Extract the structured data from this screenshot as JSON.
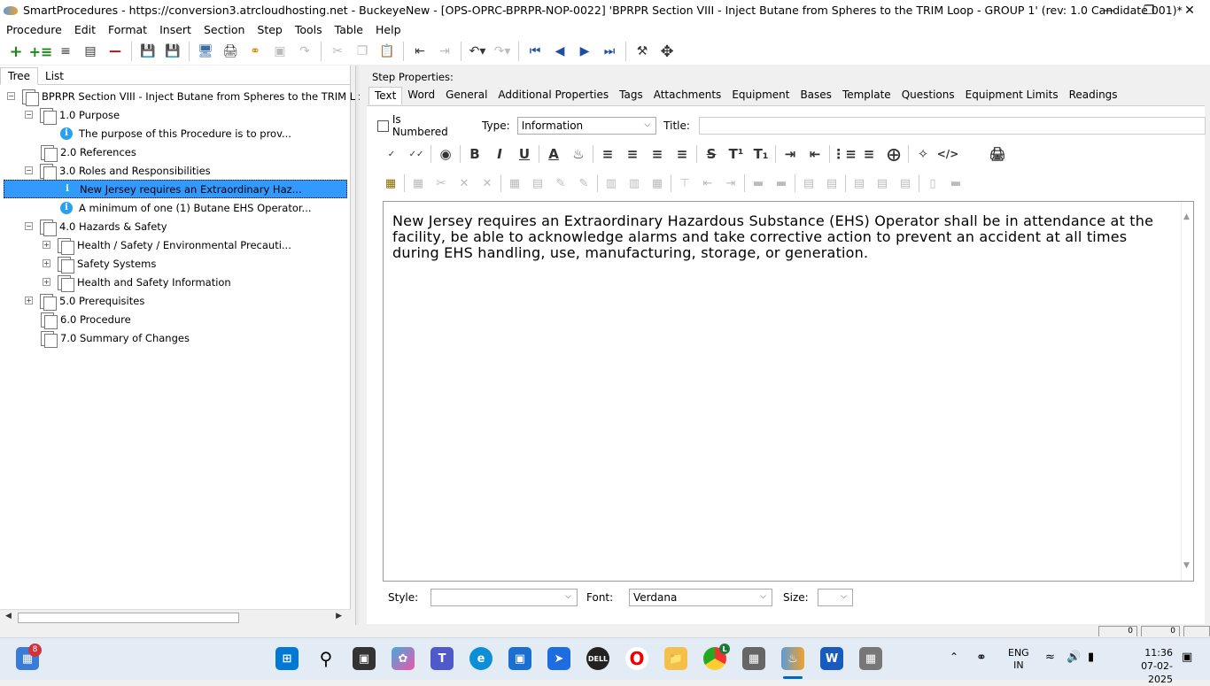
{
  "window": {
    "title": "SmartProcedures - https://conversion3.atrcloudhosting.net - BuckeyeNew - [OPS-OPRC-BPRPR-NOP-0022] 'BPRPR Section VIII - Inject Butane from Spheres to the TRIM Loop - GROUP 1' (rev: 1.0 Candidate 001)*",
    "min": "—",
    "max": "❐",
    "close": "✕"
  },
  "menu": [
    "Procedure",
    "Edit",
    "Format",
    "Insert",
    "Section",
    "Step",
    "Tools",
    "Table",
    "Help"
  ],
  "left": {
    "tabs": [
      "Tree",
      "List"
    ],
    "tree": [
      {
        "label": "BPRPR Section VIII - Inject Butane from Spheres to the TRIM Loo...",
        "expander": "−",
        "icon": "doc"
      },
      {
        "label": "1.0 Purpose",
        "expander": "−",
        "icon": "doc"
      },
      {
        "label": "The purpose of this Procedure is to prov...",
        "expander": "",
        "icon": "info"
      },
      {
        "label": "2.0 References",
        "expander": "",
        "icon": "doc"
      },
      {
        "label": "3.0 Roles and Responsibilities",
        "expander": "−",
        "icon": "doc"
      },
      {
        "label": "New Jersey requires an Extraordinary Haz...",
        "expander": "",
        "icon": "info",
        "selected": true
      },
      {
        "label": "A minimum of one (1) Butane EHS Operator...",
        "expander": "",
        "icon": "info"
      },
      {
        "label": "4.0 Hazards & Safety",
        "expander": "−",
        "icon": "doc"
      },
      {
        "label": "Health / Safety / Environmental Precauti...",
        "expander": "+",
        "icon": "doc"
      },
      {
        "label": "Safety Systems",
        "expander": "+",
        "icon": "doc"
      },
      {
        "label": "Health and Safety Information",
        "expander": "+",
        "icon": "doc"
      },
      {
        "label": "5.0 Prerequisites",
        "expander": "+",
        "icon": "doc"
      },
      {
        "label": "6.0 Procedure",
        "expander": "",
        "icon": "doc"
      },
      {
        "label": "7.0 Summary of Changes",
        "expander": "",
        "icon": "doc"
      }
    ]
  },
  "right": {
    "header": "Step Properties:",
    "tabs": [
      "Text",
      "Word",
      "General",
      "Additional Properties",
      "Tags",
      "Attachments",
      "Equipment",
      "Bases",
      "Template",
      "Questions",
      "Equipment Limits",
      "Readings"
    ],
    "is_numbered_label": "Is Numbered",
    "type_label": "Type:",
    "type_value": "Information",
    "title_label": "Title:",
    "body": "New Jersey requires an Extraordinary Hazardous Substance (EHS) Operator shall be in attendance at the facility, be able to acknowledge alarms and take corrective action to prevent an accident at all times during EHS handling, use, manufacturing, storage, or generation.",
    "style_label": "Style:",
    "font_label": "Font:",
    "font_value": "Verdana",
    "size_label": "Size:"
  },
  "status": {
    "box1": "0",
    "box2": "0"
  },
  "taskbar": {
    "widgets_badge": "8",
    "lang_line1": "ENG",
    "lang_line2": "IN",
    "time": "11:36",
    "date": "07-02-2025",
    "chrome_badge": "L"
  }
}
